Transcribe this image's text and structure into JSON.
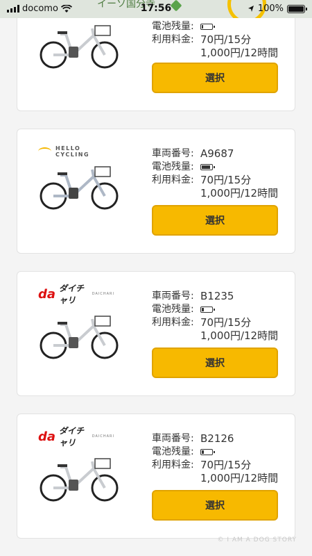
{
  "status": {
    "carrier": "docomo",
    "time": "17:56",
    "battery": "100%",
    "map_label": "イーソ国分寺"
  },
  "labels": {
    "vehicle_no": "車両番号:",
    "battery": "電池残量:",
    "fee": "利用料金:",
    "select": "選択"
  },
  "cards": [
    {
      "logo": "none",
      "vehicle_no": "",
      "battery_level": 0.15,
      "fee_line1": "70円/15分",
      "fee_line2": "1,000円/12時間"
    },
    {
      "logo": "HELLO CYCLING",
      "vehicle_no": "A9687",
      "battery_level": 0.75,
      "fee_line1": "70円/15分",
      "fee_line2": "1,000円/12時間"
    },
    {
      "logo": "ダイチャリ",
      "logo_sub": "DAICHARI",
      "logo_brand": "da",
      "vehicle_no": "B1235",
      "battery_level": 0.2,
      "fee_line1": "70円/15分",
      "fee_line2": "1,000円/12時間"
    },
    {
      "logo": "ダイチャリ",
      "logo_sub": "DAICHARI",
      "logo_brand": "da",
      "vehicle_no": "B2126",
      "battery_level": 0.2,
      "fee_line1": "70円/15分",
      "fee_line2": "1,000円/12時間"
    }
  ],
  "watermark": "© I AM A DOG STORY",
  "colors": {
    "accent": "#f7b900",
    "card_bg": "#ffffff",
    "page_bg": "#f4f4f4"
  }
}
